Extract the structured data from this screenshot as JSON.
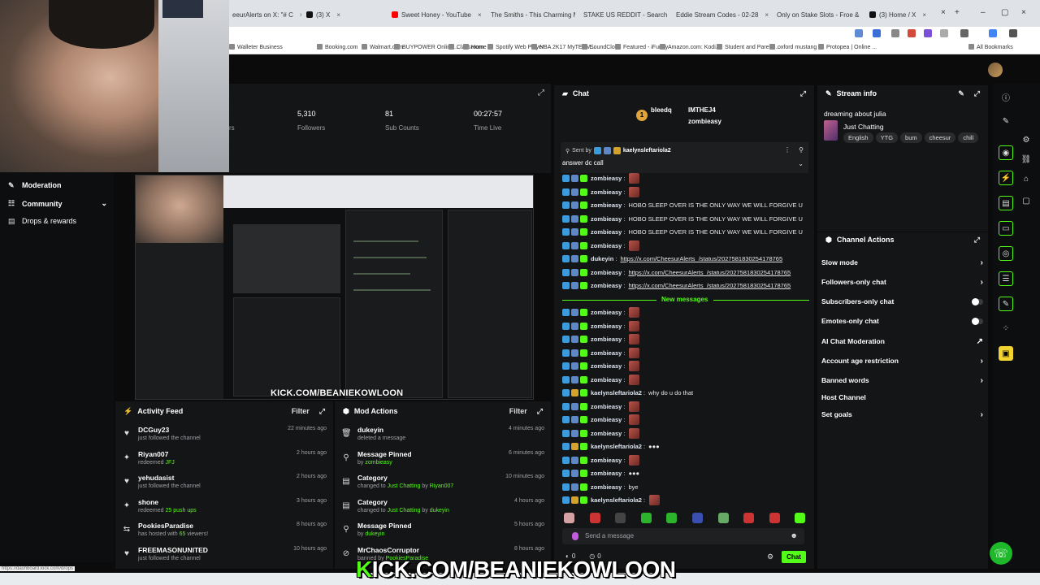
{
  "browser": {
    "tabs": [
      {
        "label": "eeurAlerts on X: \"# C",
        "color": "#111111"
      },
      {
        "label": "(3) X",
        "color": "#111111"
      },
      {
        "label": "Sweet Honey - YouTube",
        "color": "#ff0000"
      },
      {
        "label": "The Smiths - This Charming M",
        "color": "#ff0000"
      },
      {
        "label": "STAKE US REDDIT - Search",
        "color": "#1a73e8"
      },
      {
        "label": "Eddie Stream Codes - 02-28",
        "color": "#d93025"
      },
      {
        "label": "Only on Stake Slots - Froe &",
        "color": "#1a73e8"
      },
      {
        "label": "(3) Home / X",
        "color": "#111111"
      }
    ],
    "bookmarks": [
      "Walleter Business",
      "Booking.com",
      "Walmart.com",
      "BUYPOWER Online...",
      "Classroom",
      "Home",
      "Spotify Web Player",
      "NBA 2K17 MyTEAM...",
      "SoundCloud",
      "Featured - iFunny",
      "Amazon.com: Kodi...",
      "Student and Parent...",
      "oxford mustang",
      "Protopea | Online ...",
      "All Bookmarks"
    ],
    "status_url": "https://dashboard.kick.com/drops"
  },
  "stats": {
    "followers_value": "5,310",
    "followers_label": "Followers",
    "subs_value": "81",
    "subs_label": "Sub Counts",
    "time_value": "00:27:57",
    "time_label": "Time Live",
    "partial_label": "rs"
  },
  "sidebar": {
    "items": [
      {
        "label": "Moderation",
        "icon": "wrench-icon"
      },
      {
        "label": "Community",
        "icon": "people-icon"
      },
      {
        "label": "Drops & rewards",
        "icon": "gift-icon"
      }
    ]
  },
  "overlay": {
    "small": "KICK.COM/BEANIEKOWLOON",
    "big_k": "K",
    "big_rest": "ICK.COM/BEANIEKOWLOON"
  },
  "activity": {
    "title": "Activity Feed",
    "filter": "Filter",
    "rows": [
      {
        "name": "DCGuy23",
        "sub": "just followed the channel",
        "hl": "",
        "time": "22 minutes ago",
        "icon": "heart-icon"
      },
      {
        "name": "Riyan007",
        "sub": "redeemed ",
        "hl": "JFJ",
        "time": "2 hours ago",
        "icon": "gift-icon"
      },
      {
        "name": "yehudasist",
        "sub": "just followed the channel",
        "hl": "",
        "time": "2 hours ago",
        "icon": "heart-icon"
      },
      {
        "name": "shone",
        "sub": "redeemed ",
        "hl": "25 push ups",
        "time": "3 hours ago",
        "icon": "gift-icon"
      },
      {
        "name": "PookiesParadise",
        "sub": "has hosted with ",
        "hl": "65",
        "sub2": " viewers!",
        "time": "8 hours ago",
        "icon": "host-icon"
      },
      {
        "name": "FREEMASONUNITED",
        "sub": "just followed the channel",
        "hl": "",
        "time": "10 hours ago",
        "icon": "heart-icon"
      }
    ]
  },
  "mod_actions": {
    "title": "Mod Actions",
    "filter": "Filter",
    "rows": [
      {
        "name": "dukeyin",
        "sub": "deleted a message",
        "hl": "",
        "time": "4 minutes ago",
        "icon": "trash-icon"
      },
      {
        "name": "Message Pinned",
        "sub": "by ",
        "hl": "zombieasy",
        "time": "6 minutes ago",
        "icon": "pin-icon"
      },
      {
        "name": "Category",
        "sub": "changed to ",
        "hl": "Just Chatting",
        "sub2": " by ",
        "hl2": "Riyan007",
        "time": "10 minutes ago",
        "icon": "category-icon"
      },
      {
        "name": "Category",
        "sub": "changed to ",
        "hl": "Just Chatting",
        "sub2": " by ",
        "hl2": "dukeyin",
        "time": "4 hours ago",
        "icon": "category-icon"
      },
      {
        "name": "Message Pinned",
        "sub": "by ",
        "hl": "dukeyin",
        "time": "5 hours ago",
        "icon": "pin-icon"
      },
      {
        "name": "MrChaosCorruptor",
        "sub": "banned by ",
        "hl": "PookiesParadise",
        "time": "8 hours ago",
        "icon": "ban-icon"
      }
    ]
  },
  "chat": {
    "title": "Chat",
    "top_user1": "bleedq",
    "top_user2": "IMTHEJ4",
    "top_user3": "zombieasy",
    "pinned_prefix": "Sent by",
    "pinned_user": "kaelynsleftariola2",
    "pinned_text": "answer dc call",
    "new_messages": "New messages",
    "input_placeholder": "Send a message",
    "send_label": "Chat",
    "counter1": "0",
    "counter2": "0",
    "messages": [
      {
        "user": "zombieasy",
        "text": "",
        "emote": true,
        "kind": "z"
      },
      {
        "user": "zombieasy",
        "text": "",
        "emote": true,
        "kind": "z"
      },
      {
        "user": "zombieasy",
        "text": "HOBO SLEEP OVER IS THE ONLY WAY WE WILL FORGIVE U",
        "emote": false,
        "kind": "z"
      },
      {
        "user": "zombieasy",
        "text": "HOBO SLEEP OVER IS THE ONLY WAY WE WILL FORGIVE U",
        "emote": false,
        "kind": "z"
      },
      {
        "user": "zombieasy",
        "text": "HOBO SLEEP OVER IS THE ONLY WAY WE WILL FORGIVE U",
        "emote": false,
        "kind": "z"
      },
      {
        "user": "zombieasy",
        "text": "",
        "emote": true,
        "kind": "z"
      },
      {
        "user": "dukeyin",
        "text": "https://x.com/CheesurAlerts_/status/2027581830254178765",
        "emote": false,
        "kind": "z",
        "link": true
      },
      {
        "user": "zombieasy",
        "text": "https://x.com/CheesurAlerts_/status/2027581830254178765",
        "emote": false,
        "kind": "z",
        "link": true
      },
      {
        "user": "zombieasy",
        "text": "https://x.com/CheesurAlerts_/status/2027581830254178765",
        "emote": false,
        "kind": "z",
        "link": true
      }
    ],
    "messages2": [
      {
        "user": "zombieasy",
        "text": "",
        "emote": true,
        "kind": "z"
      },
      {
        "user": "zombieasy",
        "text": "",
        "emote": true,
        "kind": "z"
      },
      {
        "user": "zombieasy",
        "text": "",
        "emote": true,
        "kind": "z"
      },
      {
        "user": "zombieasy",
        "text": "",
        "emote": true,
        "kind": "z"
      },
      {
        "user": "zombieasy",
        "text": "",
        "emote": true,
        "kind": "z"
      },
      {
        "user": "zombieasy",
        "text": "",
        "emote": true,
        "kind": "z"
      },
      {
        "user": "kaelynsleftariola2",
        "text": "why do u do that",
        "emote": false,
        "kind": "k"
      },
      {
        "user": "zombieasy",
        "text": "",
        "emote": true,
        "kind": "z"
      },
      {
        "user": "zombieasy",
        "text": "",
        "emote": true,
        "kind": "z"
      },
      {
        "user": "zombieasy",
        "text": "",
        "emote": true,
        "kind": "z"
      },
      {
        "user": "kaelynsleftariola2",
        "text": "●●●",
        "emote": false,
        "kind": "k"
      },
      {
        "user": "zombieasy",
        "text": "",
        "emote": true,
        "kind": "z"
      },
      {
        "user": "zombieasy",
        "text": "●●●",
        "emote": false,
        "kind": "z"
      },
      {
        "user": "zombieasy",
        "text": "bye",
        "emote": false,
        "kind": "z"
      },
      {
        "user": "kaelynsleftariola2",
        "text": "",
        "emote": true,
        "kind": "k"
      }
    ]
  },
  "stream_info": {
    "title": "Stream info",
    "stream_title": "dreaming about julia",
    "category": "Just Chatting",
    "tags": [
      "English",
      "YTG",
      "bum",
      "cheesur",
      "chill"
    ]
  },
  "channel_actions": {
    "title": "Channel Actions",
    "rows": [
      {
        "label": "Slow mode",
        "ctrl": "chev"
      },
      {
        "label": "Followers-only chat",
        "ctrl": "chev"
      },
      {
        "label": "Subscribers-only chat",
        "ctrl": "toggle"
      },
      {
        "label": "Emotes-only chat",
        "ctrl": "toggle"
      },
      {
        "label": "AI Chat Moderation",
        "ctrl": "ext"
      },
      {
        "label": "Account age restriction",
        "ctrl": "chev"
      },
      {
        "label": "Banned words",
        "ctrl": "chev"
      },
      {
        "label": "Host Channel",
        "ctrl": "none"
      },
      {
        "label": "Set goals",
        "ctrl": "chev"
      }
    ]
  },
  "colors": {
    "accent": "#53fc18",
    "panel": "#141516",
    "bg": "#0b0b0c"
  }
}
